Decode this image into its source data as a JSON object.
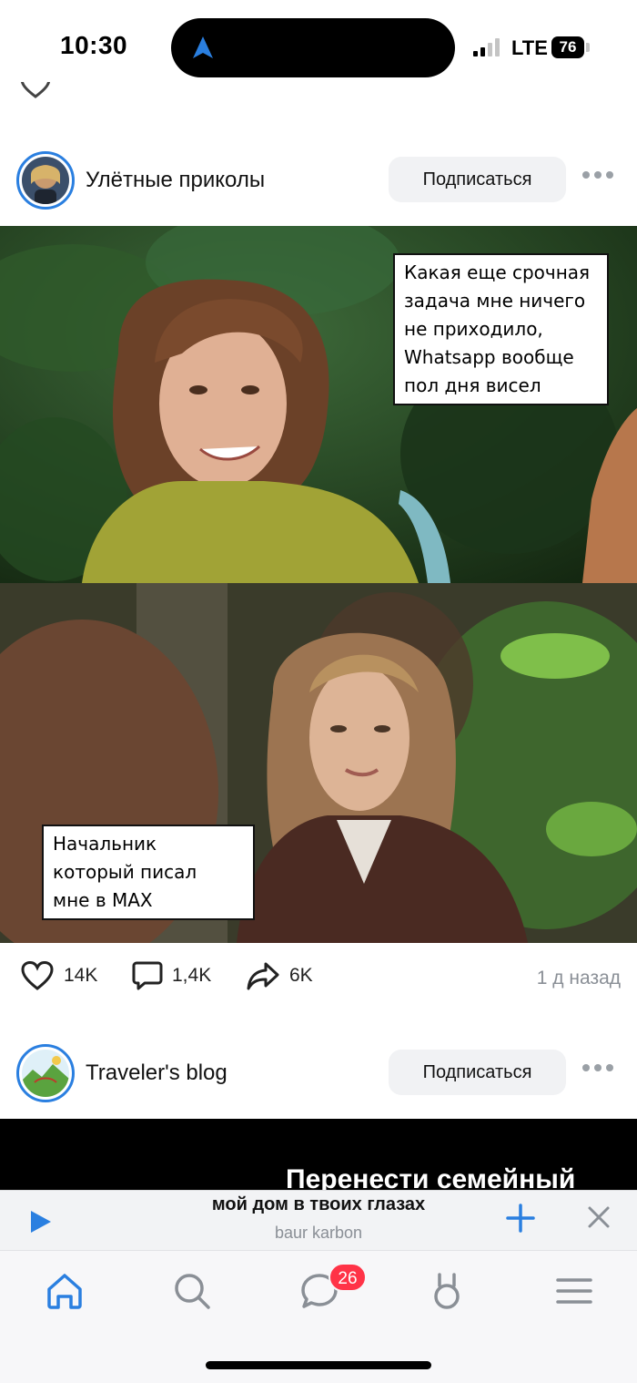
{
  "status_bar": {
    "time": "10:30",
    "network": "LTE",
    "battery": "76"
  },
  "posts": [
    {
      "author": "Улётные приколы",
      "subscribe_label": "Подписаться",
      "captions": {
        "top": [
          "Какая еще срочная",
          "задача мне ничего",
          "не приходило,",
          "Whatsapp вообще",
          "пол дня висел"
        ],
        "bottom": [
          "Начальник",
          "который писал",
          "мне в MAX"
        ]
      },
      "likes": "14K",
      "comments": "1,4K",
      "shares": "6K",
      "time_ago": "1 д назад"
    },
    {
      "author": "Traveler's blog",
      "subscribe_label": "Подписаться",
      "media_text": "Перенести семейный"
    }
  ],
  "player": {
    "track": "мой дом в твоих глазах",
    "artist": "baur karbon"
  },
  "tabbar": {
    "messages_badge": "26"
  },
  "colors": {
    "accent": "#2a7fe0",
    "badge": "#ff3347"
  }
}
